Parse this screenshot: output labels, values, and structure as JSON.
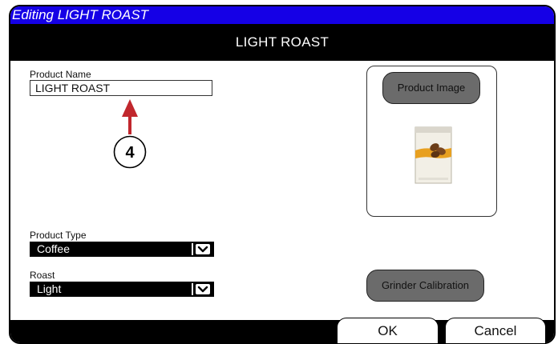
{
  "window": {
    "title": "Editing LIGHT ROAST",
    "header": "LIGHT ROAST"
  },
  "form": {
    "product_name_label": "Product Name",
    "product_name_value": "LIGHT ROAST",
    "product_type_label": "Product Type",
    "product_type_value": "Coffee",
    "roast_label": "Roast",
    "roast_value": "Light"
  },
  "image_panel": {
    "product_image_button": "Product Image",
    "image_icon": "coffee-bag-icon"
  },
  "buttons": {
    "grinder_calibration": "Grinder Calibration",
    "ok": "OK",
    "cancel": "Cancel"
  },
  "callout": {
    "number": "4",
    "color": "#c1272d"
  },
  "colors": {
    "titlebar": "#1500e6",
    "header": "#000000",
    "pill_button": "#6b6b6b"
  }
}
